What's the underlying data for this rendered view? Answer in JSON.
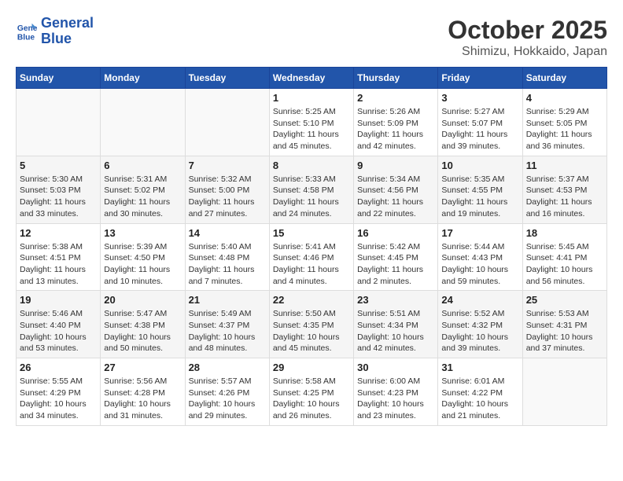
{
  "header": {
    "logo_line1": "General",
    "logo_line2": "Blue",
    "title": "October 2025",
    "subtitle": "Shimizu, Hokkaido, Japan"
  },
  "weekdays": [
    "Sunday",
    "Monday",
    "Tuesday",
    "Wednesday",
    "Thursday",
    "Friday",
    "Saturday"
  ],
  "weeks": [
    [
      {
        "day": "",
        "info": ""
      },
      {
        "day": "",
        "info": ""
      },
      {
        "day": "",
        "info": ""
      },
      {
        "day": "1",
        "info": "Sunrise: 5:25 AM\nSunset: 5:10 PM\nDaylight: 11 hours and 45 minutes."
      },
      {
        "day": "2",
        "info": "Sunrise: 5:26 AM\nSunset: 5:09 PM\nDaylight: 11 hours and 42 minutes."
      },
      {
        "day": "3",
        "info": "Sunrise: 5:27 AM\nSunset: 5:07 PM\nDaylight: 11 hours and 39 minutes."
      },
      {
        "day": "4",
        "info": "Sunrise: 5:29 AM\nSunset: 5:05 PM\nDaylight: 11 hours and 36 minutes."
      }
    ],
    [
      {
        "day": "5",
        "info": "Sunrise: 5:30 AM\nSunset: 5:03 PM\nDaylight: 11 hours and 33 minutes."
      },
      {
        "day": "6",
        "info": "Sunrise: 5:31 AM\nSunset: 5:02 PM\nDaylight: 11 hours and 30 minutes."
      },
      {
        "day": "7",
        "info": "Sunrise: 5:32 AM\nSunset: 5:00 PM\nDaylight: 11 hours and 27 minutes."
      },
      {
        "day": "8",
        "info": "Sunrise: 5:33 AM\nSunset: 4:58 PM\nDaylight: 11 hours and 24 minutes."
      },
      {
        "day": "9",
        "info": "Sunrise: 5:34 AM\nSunset: 4:56 PM\nDaylight: 11 hours and 22 minutes."
      },
      {
        "day": "10",
        "info": "Sunrise: 5:35 AM\nSunset: 4:55 PM\nDaylight: 11 hours and 19 minutes."
      },
      {
        "day": "11",
        "info": "Sunrise: 5:37 AM\nSunset: 4:53 PM\nDaylight: 11 hours and 16 minutes."
      }
    ],
    [
      {
        "day": "12",
        "info": "Sunrise: 5:38 AM\nSunset: 4:51 PM\nDaylight: 11 hours and 13 minutes."
      },
      {
        "day": "13",
        "info": "Sunrise: 5:39 AM\nSunset: 4:50 PM\nDaylight: 11 hours and 10 minutes."
      },
      {
        "day": "14",
        "info": "Sunrise: 5:40 AM\nSunset: 4:48 PM\nDaylight: 11 hours and 7 minutes."
      },
      {
        "day": "15",
        "info": "Sunrise: 5:41 AM\nSunset: 4:46 PM\nDaylight: 11 hours and 4 minutes."
      },
      {
        "day": "16",
        "info": "Sunrise: 5:42 AM\nSunset: 4:45 PM\nDaylight: 11 hours and 2 minutes."
      },
      {
        "day": "17",
        "info": "Sunrise: 5:44 AM\nSunset: 4:43 PM\nDaylight: 10 hours and 59 minutes."
      },
      {
        "day": "18",
        "info": "Sunrise: 5:45 AM\nSunset: 4:41 PM\nDaylight: 10 hours and 56 minutes."
      }
    ],
    [
      {
        "day": "19",
        "info": "Sunrise: 5:46 AM\nSunset: 4:40 PM\nDaylight: 10 hours and 53 minutes."
      },
      {
        "day": "20",
        "info": "Sunrise: 5:47 AM\nSunset: 4:38 PM\nDaylight: 10 hours and 50 minutes."
      },
      {
        "day": "21",
        "info": "Sunrise: 5:49 AM\nSunset: 4:37 PM\nDaylight: 10 hours and 48 minutes."
      },
      {
        "day": "22",
        "info": "Sunrise: 5:50 AM\nSunset: 4:35 PM\nDaylight: 10 hours and 45 minutes."
      },
      {
        "day": "23",
        "info": "Sunrise: 5:51 AM\nSunset: 4:34 PM\nDaylight: 10 hours and 42 minutes."
      },
      {
        "day": "24",
        "info": "Sunrise: 5:52 AM\nSunset: 4:32 PM\nDaylight: 10 hours and 39 minutes."
      },
      {
        "day": "25",
        "info": "Sunrise: 5:53 AM\nSunset: 4:31 PM\nDaylight: 10 hours and 37 minutes."
      }
    ],
    [
      {
        "day": "26",
        "info": "Sunrise: 5:55 AM\nSunset: 4:29 PM\nDaylight: 10 hours and 34 minutes."
      },
      {
        "day": "27",
        "info": "Sunrise: 5:56 AM\nSunset: 4:28 PM\nDaylight: 10 hours and 31 minutes."
      },
      {
        "day": "28",
        "info": "Sunrise: 5:57 AM\nSunset: 4:26 PM\nDaylight: 10 hours and 29 minutes."
      },
      {
        "day": "29",
        "info": "Sunrise: 5:58 AM\nSunset: 4:25 PM\nDaylight: 10 hours and 26 minutes."
      },
      {
        "day": "30",
        "info": "Sunrise: 6:00 AM\nSunset: 4:23 PM\nDaylight: 10 hours and 23 minutes."
      },
      {
        "day": "31",
        "info": "Sunrise: 6:01 AM\nSunset: 4:22 PM\nDaylight: 10 hours and 21 minutes."
      },
      {
        "day": "",
        "info": ""
      }
    ]
  ]
}
